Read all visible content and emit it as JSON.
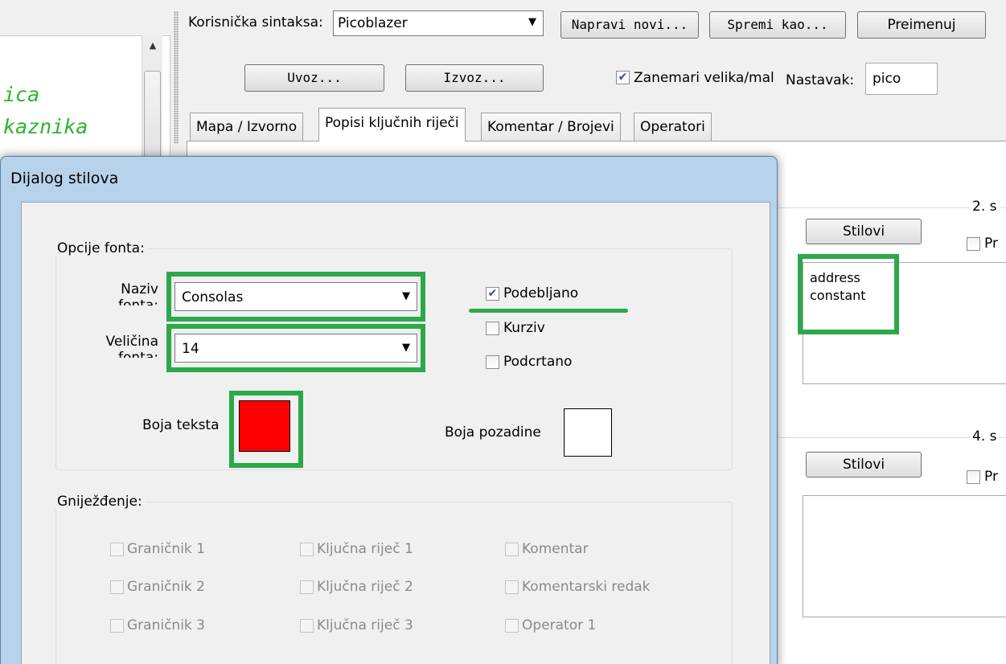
{
  "editor": {
    "lines": [
      "ica",
      "kaznika"
    ]
  },
  "toolbar": {
    "syntax_label": "Korisnička sintaksa:",
    "syntax_value": "Picoblazer",
    "btn_new": "Napravi novi...",
    "btn_save_as": "Spremi kao...",
    "btn_rename": "Preimenuj",
    "btn_import": "Uvoz...",
    "btn_export": "Izvoz...",
    "ignore_case_label": "Zanemari velika/mal",
    "ignore_case_checked": true,
    "extension_label": "Nastavak:",
    "extension_value": "pico"
  },
  "tabs": [
    {
      "label": "Mapa / Izvorno",
      "active": false
    },
    {
      "label": "Popisi ključnih riječi",
      "active": true
    },
    {
      "label": "Komentar / Brojevi",
      "active": false
    },
    {
      "label": "Operatori",
      "active": false
    }
  ],
  "keyword_groups": [
    {
      "title": "2. s",
      "styles_button": "Stilovi",
      "check_label": "Pr",
      "words": [
        "address",
        "constant"
      ]
    },
    {
      "title": "4. s",
      "styles_button": "Stilovi",
      "check_label": "Pr",
      "words": []
    }
  ],
  "dialog": {
    "title": "Dijalog stilova",
    "font_group_label": "Opcije fonta:",
    "font_name_label": "Naziv fonta:",
    "font_name_value": "Consolas",
    "font_size_label": "Veličina fonta:",
    "font_size_value": "14",
    "bold_label": "Podebljano",
    "bold_checked": true,
    "italic_label": "Kurziv",
    "italic_checked": false,
    "underline_label": "Podcrtano",
    "underline_checked": false,
    "text_color_label": "Boja teksta",
    "text_color": "#ff0000",
    "bg_color_label": "Boja pozadine",
    "bg_color": "#ffffff",
    "nesting_group_label": "Gniježđenje:",
    "nesting_items": [
      "Graničnik 1",
      "Ključna riječ 1",
      "Komentar",
      "Graničnik 2",
      "Ključna riječ 2",
      "Komentarski redak",
      "Graničnik 3",
      "Ključna riječ 3",
      "Operator 1"
    ]
  },
  "colors": {
    "highlight": "#2ca84a",
    "code_text": "#2db52d"
  }
}
